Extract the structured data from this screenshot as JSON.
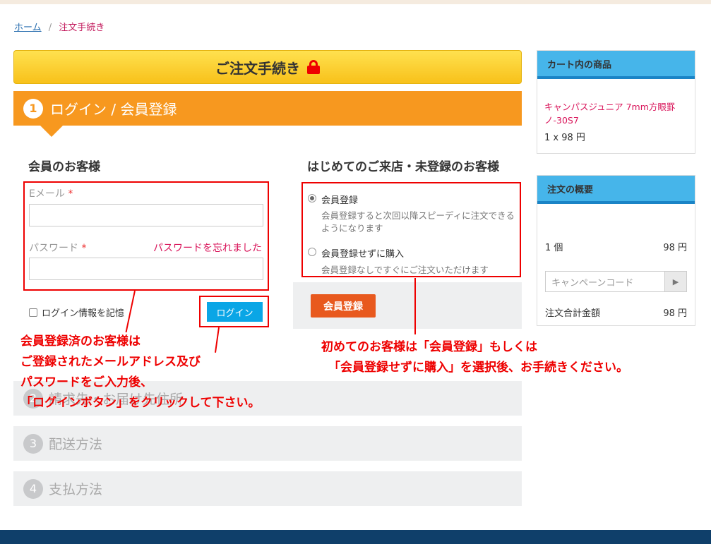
{
  "breadcrumb": {
    "home": "ホーム",
    "separator": "/",
    "current": "注文手続き"
  },
  "checkout_title": "ご注文手続き",
  "step1": {
    "number": "1",
    "title": "ログイン / 会員登録"
  },
  "members": {
    "heading": "会員のお客様",
    "email_label": "Eメール",
    "password_label": "パスワード",
    "required_mark": "*",
    "forgot_link": "パスワードを忘れました",
    "email_value": "",
    "password_value": "",
    "remember_label": "ログイン情報を記憶",
    "login_button": "ログイン"
  },
  "guest": {
    "heading": "はじめてのご来店・未登録のお客様",
    "option1_label": "会員登録",
    "option1_desc_line1": "会員登録すると次回以降スピーディに注文できる",
    "option1_desc_line2": "ようになります",
    "option2_label": "会員登録せずに購入",
    "option2_desc": "会員登録なしですぐにご注文いただけます",
    "register_button": "会員登録"
  },
  "steps": [
    {
      "number": "2",
      "title": "請求先・お届け先住所"
    },
    {
      "number": "3",
      "title": "配送方法"
    },
    {
      "number": "4",
      "title": "支払方法"
    }
  ],
  "annotations": {
    "left": [
      "会員登録済のお客様は",
      "ご登録されたメールアドレス及び",
      "パスワードをご入力後、",
      "「ログインボタン」をクリックして下さい。"
    ],
    "right": [
      "初めてのお客様は「会員登録」もしくは",
      "「会員登録せずに購入」を選択後、お手続きください。"
    ]
  },
  "cart": {
    "header": "カート内の商品",
    "item_name": "キャンパスジュニア 7mm方眼罫ノ-30S7",
    "item_price": "1 x 98 円"
  },
  "summary": {
    "header": "注文の概要",
    "count_label": "1 個",
    "count_value": "98 円",
    "campaign_placeholder": "キャンペーンコード",
    "total_label": "注文合計金額",
    "total_value": "98 円"
  },
  "colors": {
    "accent_orange": "#f7981f",
    "annotation_red": "#ee0000",
    "link_pink": "#d9165b",
    "header_blue": "#46b5ea"
  },
  "icons": {
    "lock": "lock-icon",
    "campaign_submit": "play-icon"
  }
}
